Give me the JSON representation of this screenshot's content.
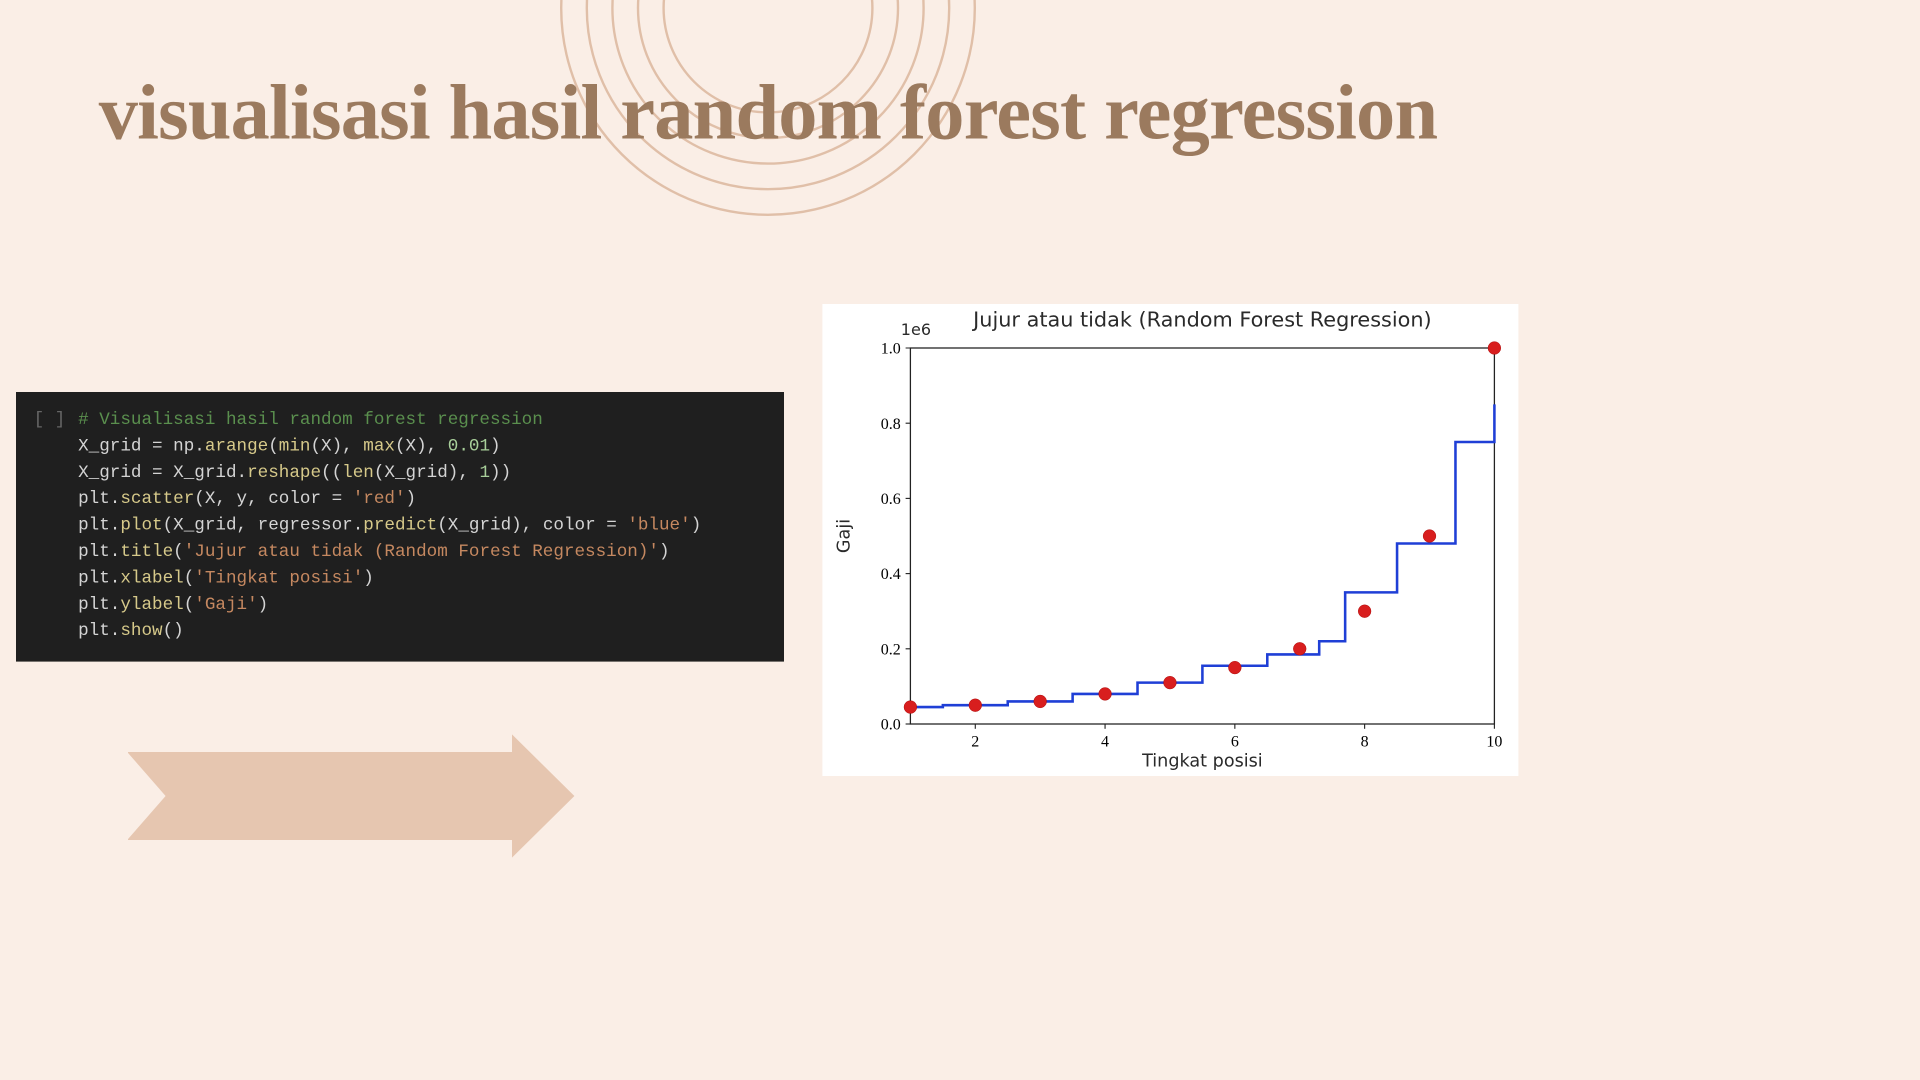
{
  "title": "visualisasi hasil random forest regression",
  "code": {
    "cell_marker": "[ ]",
    "lines": [
      {
        "type": "comment",
        "text": "# Visualisasi hasil random forest regression"
      },
      {
        "type": "code",
        "tokens": [
          {
            "t": "plain",
            "v": "X_grid = np."
          },
          {
            "t": "fn",
            "v": "arange"
          },
          {
            "t": "plain",
            "v": "("
          },
          {
            "t": "fn",
            "v": "min"
          },
          {
            "t": "plain",
            "v": "(X), "
          },
          {
            "t": "fn",
            "v": "max"
          },
          {
            "t": "plain",
            "v": "(X), "
          },
          {
            "t": "num",
            "v": "0.01"
          },
          {
            "t": "plain",
            "v": ")"
          }
        ]
      },
      {
        "type": "code",
        "tokens": [
          {
            "t": "plain",
            "v": "X_grid = X_grid."
          },
          {
            "t": "fn",
            "v": "reshape"
          },
          {
            "t": "plain",
            "v": "(("
          },
          {
            "t": "fn",
            "v": "len"
          },
          {
            "t": "plain",
            "v": "(X_grid), "
          },
          {
            "t": "num",
            "v": "1"
          },
          {
            "t": "plain",
            "v": "))"
          }
        ]
      },
      {
        "type": "code",
        "tokens": [
          {
            "t": "plain",
            "v": "plt."
          },
          {
            "t": "fn",
            "v": "scatter"
          },
          {
            "t": "plain",
            "v": "(X, y, color = "
          },
          {
            "t": "str",
            "v": "'red'"
          },
          {
            "t": "plain",
            "v": ")"
          }
        ]
      },
      {
        "type": "code",
        "tokens": [
          {
            "t": "plain",
            "v": "plt."
          },
          {
            "t": "fn",
            "v": "plot"
          },
          {
            "t": "plain",
            "v": "(X_grid, regressor."
          },
          {
            "t": "fn",
            "v": "predict"
          },
          {
            "t": "plain",
            "v": "(X_grid), color = "
          },
          {
            "t": "str",
            "v": "'blue'"
          },
          {
            "t": "plain",
            "v": ")"
          }
        ]
      },
      {
        "type": "code",
        "tokens": [
          {
            "t": "plain",
            "v": "plt."
          },
          {
            "t": "fn",
            "v": "title"
          },
          {
            "t": "plain",
            "v": "("
          },
          {
            "t": "str",
            "v": "'Jujur atau tidak (Random Forest Regression)'"
          },
          {
            "t": "plain",
            "v": ")"
          }
        ]
      },
      {
        "type": "code",
        "tokens": [
          {
            "t": "plain",
            "v": "plt."
          },
          {
            "t": "fn",
            "v": "xlabel"
          },
          {
            "t": "plain",
            "v": "("
          },
          {
            "t": "str",
            "v": "'Tingkat posisi'"
          },
          {
            "t": "plain",
            "v": ")"
          }
        ]
      },
      {
        "type": "code",
        "tokens": [
          {
            "t": "plain",
            "v": "plt."
          },
          {
            "t": "fn",
            "v": "ylabel"
          },
          {
            "t": "plain",
            "v": "("
          },
          {
            "t": "str",
            "v": "'Gaji'"
          },
          {
            "t": "plain",
            "v": ")"
          }
        ]
      },
      {
        "type": "code",
        "tokens": [
          {
            "t": "plain",
            "v": "plt."
          },
          {
            "t": "fn",
            "v": "show"
          },
          {
            "t": "plain",
            "v": "()"
          }
        ]
      }
    ]
  },
  "chart_data": {
    "type": "scatter",
    "title": "Jujur atau tidak (Random Forest Regression)",
    "xlabel": "Tingkat posisi",
    "ylabel": "Gaji",
    "y_exponent_label": "1e6",
    "xlim": [
      1,
      10
    ],
    "ylim": [
      0,
      1.0
    ],
    "xticks": [
      2,
      4,
      6,
      8,
      10
    ],
    "yticks": [
      0.0,
      0.2,
      0.4,
      0.6,
      0.8,
      1.0
    ],
    "scatter": {
      "x": [
        1,
        2,
        3,
        4,
        5,
        6,
        7,
        8,
        9,
        10
      ],
      "y": [
        0.045,
        0.05,
        0.06,
        0.08,
        0.11,
        0.15,
        0.2,
        0.3,
        0.5,
        1.0
      ],
      "color": "red"
    },
    "step_line": {
      "color": "blue",
      "breakpoints": [
        1.0,
        1.5,
        2.5,
        3.5,
        4.5,
        5.5,
        6.5,
        7.3,
        7.7,
        8.5,
        9.4,
        10.0
      ],
      "levels": [
        0.045,
        0.05,
        0.06,
        0.08,
        0.11,
        0.155,
        0.185,
        0.22,
        0.35,
        0.48,
        0.75,
        0.85
      ]
    }
  }
}
